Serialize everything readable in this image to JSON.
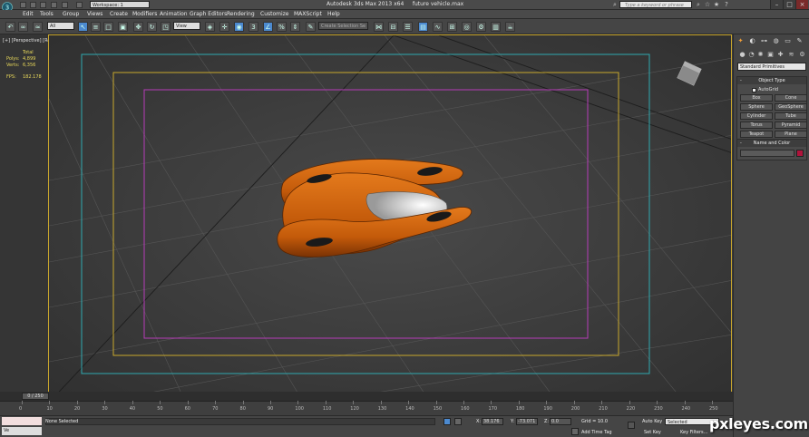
{
  "titlebar": {
    "workspace": "Workspace: 1",
    "app_title": "Autodesk 3ds Max 2013 x64",
    "file_name": "future vehicle.max",
    "search_placeholder": "Type a keyword or phrase"
  },
  "menu": {
    "items": [
      "Edit",
      "Tools",
      "Group",
      "Views",
      "Create",
      "Modifiers",
      "Animation",
      "Graph Editors",
      "Rendering",
      "Customize",
      "MAXScript",
      "Help"
    ]
  },
  "toolbar": {
    "selection_filter": "All",
    "ref_coord": "View",
    "named_sel": "Create Selection Se"
  },
  "viewport": {
    "label": "[+] [Perspective] [Realistic]",
    "stats": {
      "header": "Total",
      "polys_label": "Polys:",
      "polys_value": "4,899",
      "verts_label": "Verts:",
      "verts_value": "6,356",
      "fps_label": "FPS:",
      "fps_value": "182.178"
    },
    "colors": {
      "vehicle_body": "#d2650f",
      "safe_frame_outer": "#2fa9b0",
      "safe_frame_mid": "#c8a82c",
      "safe_frame_inner": "#b63cb8"
    }
  },
  "command_panel": {
    "dropdown": "Standard Primitives",
    "object_type": {
      "title": "Object Type",
      "autogrid": "AutoGrid",
      "buttons": [
        "Box",
        "Cone",
        "Sphere",
        "GeoSphere",
        "Cylinder",
        "Tube",
        "Torus",
        "Pyramid",
        "Teapot",
        "Plane"
      ]
    },
    "name_color": {
      "title": "Name and Color",
      "swatch_color": "#b0143c"
    }
  },
  "timeline": {
    "frame_display": "0 / 250",
    "ticks": [
      "0",
      "10",
      "20",
      "30",
      "40",
      "50",
      "60",
      "70",
      "80",
      "90",
      "100",
      "110",
      "120",
      "130",
      "140",
      "150",
      "160",
      "170",
      "180",
      "190",
      "200",
      "210",
      "220",
      "230",
      "240",
      "250"
    ]
  },
  "status": {
    "maxscript_label": "Ve",
    "selection": "None Selected",
    "x_label": "X:",
    "x_value": "38.176",
    "y_label": "Y:",
    "y_value": "-73.071",
    "z_label": "Z:",
    "z_value": "0.0",
    "grid": "Grid = 10.0",
    "add_time_tag": "Add Time Tag",
    "auto_key": "Auto Key",
    "selected": "Selected",
    "set_key": "Set Key",
    "key_filters": "Key Filters..."
  },
  "watermark": "pxleyes.com"
}
